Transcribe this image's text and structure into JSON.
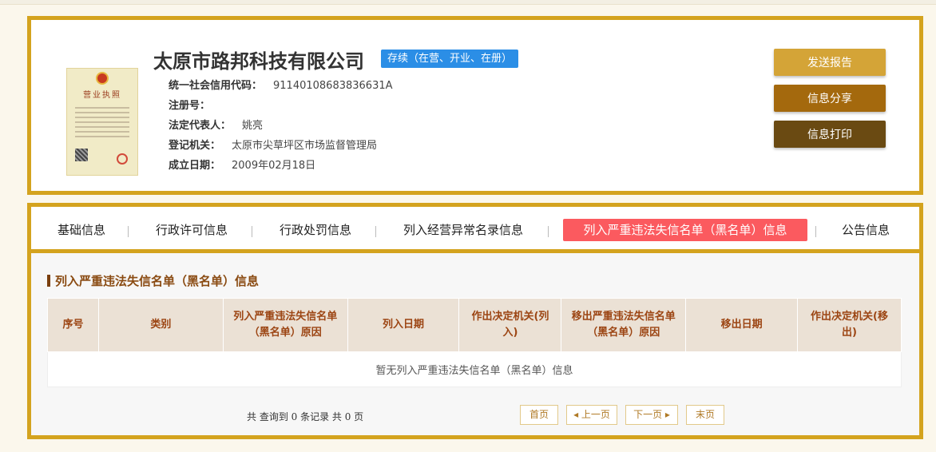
{
  "company": {
    "name": "太原市路邦科技有限公司",
    "status": "存续（在营、开业、在册）",
    "license_title": "营业执照"
  },
  "info": [
    {
      "label": "统一社会信用代码：",
      "value": "91140108683836631A"
    },
    {
      "label": "注册号：",
      "value": ""
    },
    {
      "label": "法定代表人：",
      "value": "姚亮"
    },
    {
      "label": "登记机关：",
      "value": "太原市尖草坪区市场监督管理局"
    },
    {
      "label": "成立日期：",
      "value": "2009年02月18日"
    }
  ],
  "actions": {
    "report": "发送报告",
    "share": "信息分享",
    "print": "信息打印"
  },
  "tabs": [
    "基础信息",
    "行政许可信息",
    "行政处罚信息",
    "列入经营异常名录信息",
    "列入严重违法失信名单（黑名单）信息",
    "公告信息"
  ],
  "section": {
    "title": "列入严重违法失信名单（黑名单）信息",
    "columns": [
      "序号",
      "类别",
      "列入严重违法失信名单（黑名单）原因",
      "列入日期",
      "作出决定机关(列入)",
      "移出严重违法失信名单（黑名单）原因",
      "移出日期",
      "作出决定机关(移出)"
    ],
    "empty_text": "暂无列入严重违法失信名单（黑名单）信息"
  },
  "pager": {
    "summary": "共 查询到 0 条记录 共 0 页",
    "first": "首页",
    "prev": "◂ 上一页",
    "next": "下一页 ▸",
    "last": "末页"
  },
  "colors": {
    "frame": "#d4a31e",
    "status_badge": "#2b8ee6",
    "active_tab": "#fb5a5f",
    "report_btn": "#d4a437",
    "share_btn": "#a4690d",
    "print_btn": "#6a4a12"
  }
}
